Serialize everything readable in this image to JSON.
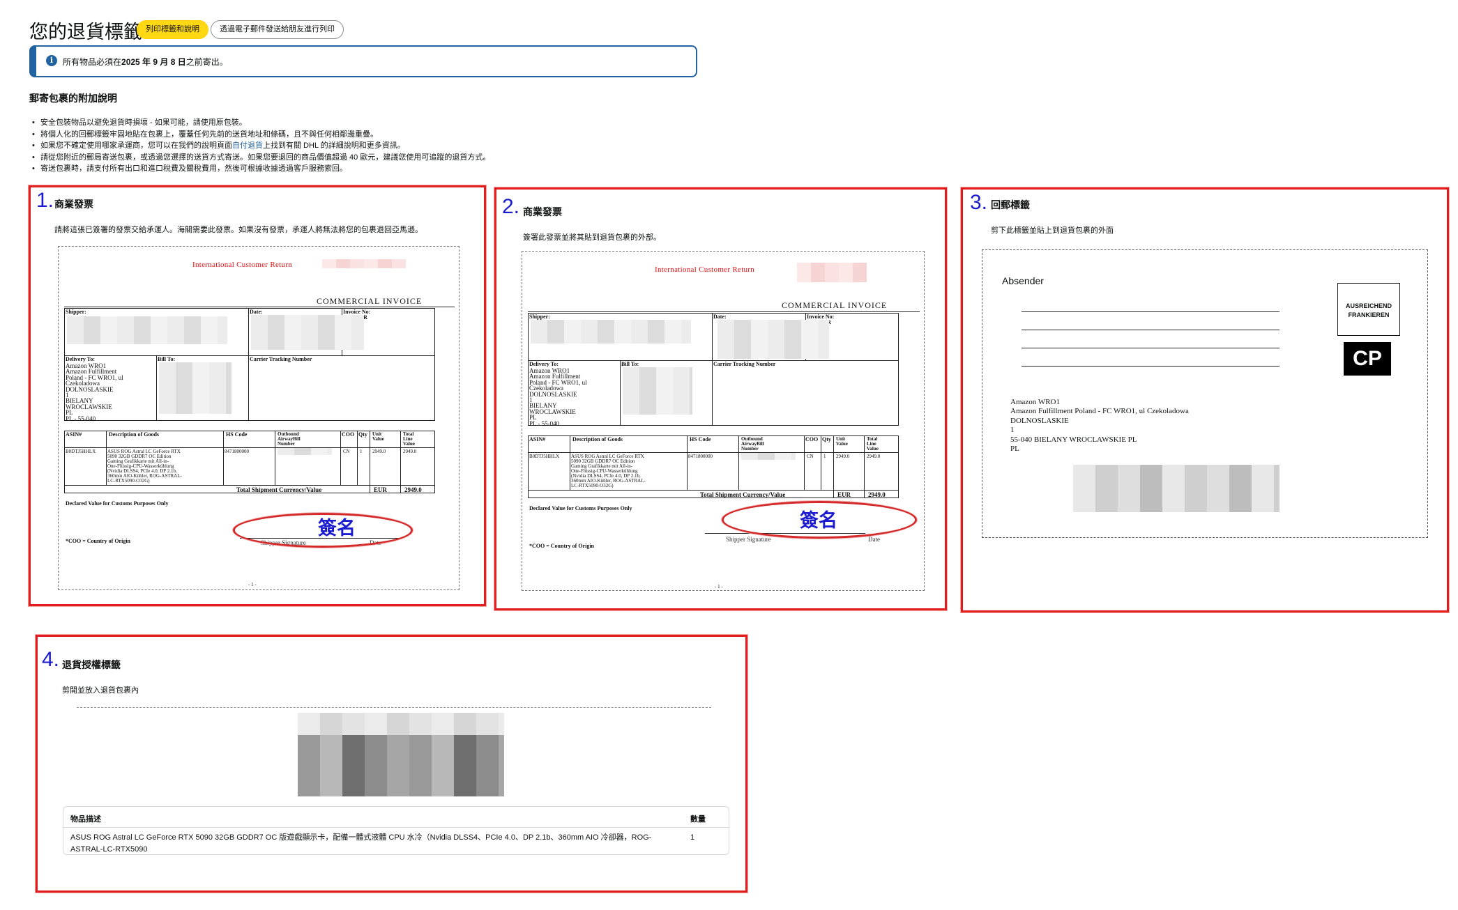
{
  "header": {
    "title": "您的退貨標籤",
    "print_button": "列印標籤和說明",
    "email_button": "透過電子郵件發送給朋友進行列印"
  },
  "alert": {
    "icon": "info-icon",
    "prefix": "所有物品必須在",
    "date": "2025 年 9 月 8 日",
    "suffix": "之前寄出。"
  },
  "instructions": {
    "title": "郵寄包裹的附加說明",
    "items": [
      "安全包裝物品以避免退貨時損壞 - 如果可能，請使用原包裝。",
      "將個人化的回郵標籤牢固地貼在包裹上，覆蓋任何先前的送貨地址和條碼，且不與任何相鄰邊重疊。"
    ],
    "item3_pre": "如果您不確定使用哪家承運商，您可以在我們的說明頁面",
    "item3_link": "自付退貨",
    "item3_post": "上找到有關 DHL 的詳細說明和更多資訊。",
    "item4": "請從您附近的郵局寄送包裹，或透過您選擇的送貨方式寄送。如果您要退回的商品價值超過 40 歐元，建議您使用可追蹤的退貨方式。",
    "item5": "寄送包裹時，請支付所有出口和進口稅費及關稅費用，然後可根據收據透過客戶服務索回。"
  },
  "panel1": {
    "number": "1.",
    "title": "商業發票",
    "subtitle": "請將這張已簽署的發票交給承運人。海關需要此發票。如果沒有發票，承運人將無法將您的包裹退回亞馬遜。"
  },
  "panel2": {
    "number": "2.",
    "title": "商業發票",
    "subtitle": "簽署此發票並將其貼到退貨包裹的外部。"
  },
  "panel3": {
    "number": "3.",
    "title": "回郵標籤",
    "subtitle": "剪下此標籤並貼上到退貨包裹的外面"
  },
  "panel4": {
    "number": "4.",
    "title": "退貨授權標籤",
    "subtitle": "剪開並放入退貨包裹內"
  },
  "invoice": {
    "red_title": "International Customer Return",
    "heading": "COMMERCIAL INVOICE",
    "shipper": "Shipper:",
    "date": "Date:",
    "invoice_no": "Invoice No:",
    "omer": "OMER",
    "rn": "RN",
    "delivery_to": "Delivery To:",
    "delivery_addr": "Amazon WRO1\nAmazon Fulfillment\nPoland - FC WRO1, ul\nCzekoladowa\nDOLNOSLASKIE\n1\nBIELANY\nWROCLAWSKIE\nPL\nPL - 55-040",
    "bill_to": "Bill To:",
    "carrier": "Carrier Tracking Number",
    "col_asin": "ASIN#",
    "col_desc": "Description of Goods",
    "col_hs": "HS Code",
    "col_awb": "Outbound\nAirwayBill\nNumber",
    "col_coo": "COO",
    "col_qty": "Qty",
    "col_unit": "Unit\nValue",
    "col_total": "Total\nLine\nValue",
    "row_asin": "B0DTJ5HHLX",
    "row_desc": "ASUS ROG Astral LC GeForce RTX\n5090 32GB GDDR7 OC Edition\nGaming Grafikkarte mit All-in-\nOne-Flüssig-CPU-Wasserkühlung\n(Nvidia DLSS4, PCIe 4.0, DP 2.1b,\n360mm AIO-Kühler, ROG-ASTRAL-\nLC-RTX5090-O32G)",
    "row_hs": "8471800000",
    "row_coo": "CN",
    "row_qty": "1",
    "row_unit": "2949.0",
    "row_total": "2949.0",
    "total_label": "Total Shipment Currency/Value",
    "currency": "EUR",
    "total_value": "2949.0",
    "declared": "Declared Value for Customs Purposes Only",
    "shipper_signature": "Shipper Signature",
    "date_label": "Date",
    "coo_note": "*COO = Country of Origin",
    "page": "- 1 -",
    "signature_note": "簽名"
  },
  "return_label": {
    "sender": "Absender",
    "stamp": "AUSREICHEND\nFRANKIEREN",
    "cp": "CP",
    "address": [
      "Amazon WRO1",
      "Amazon Fulfillment Poland - FC WRO1, ul Czekoladowa",
      "DOLNOSLASKIE",
      "1",
      "55-040 BIELANY WROCLAWSKIE PL",
      "PL"
    ]
  },
  "rma_table": {
    "col_item": "物品描述",
    "col_qty": "數量",
    "item_desc": "ASUS ROG Astral LC GeForce RTX 5090 32GB GDDR7 OC 版遊戲顯示卡，配備一體式液體 CPU 水冷（Nvidia DLSS4、PCIe 4.0、DP 2.1b、360mm AIO 冷卻器，ROG-ASTRAL-LC-RTX5090",
    "qty": "1"
  },
  "colors": {
    "highlight_border": "#e01e1e",
    "number_blue": "#1b1bcf",
    "primary_button": "#ffd814",
    "alert_blue": "#2162a1"
  }
}
